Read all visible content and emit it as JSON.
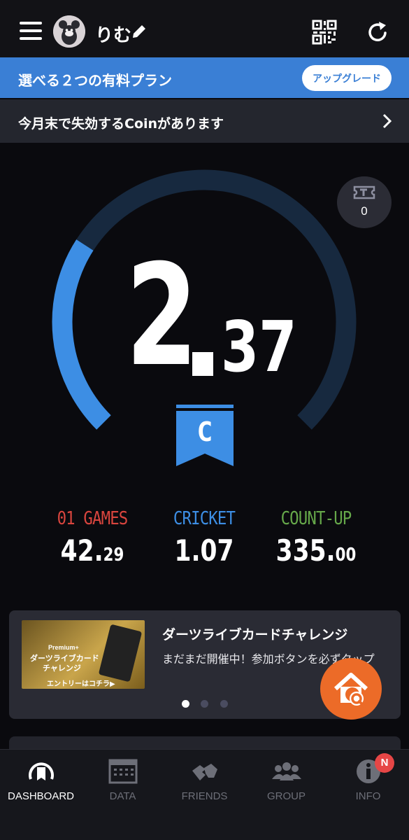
{
  "header": {
    "username": "りむ",
    "icons": [
      "menu-icon",
      "avatar",
      "edit-pencil-icon",
      "qr-code-icon",
      "reload-icon"
    ]
  },
  "upgrade_banner": {
    "text": "選べる２つの有料プラン",
    "button_label": "アップグレード",
    "color": "#3a7fd5"
  },
  "coin_notice": {
    "text": "今月末で失効するCoinがあります"
  },
  "gauge": {
    "rating_integer": "2",
    "rating_decimal": "37",
    "rating_value": 2.37,
    "rank": "C",
    "progress_fraction": 0.14,
    "ticket_count": "0",
    "colors": {
      "arc_fill": "#3d8ee4",
      "arc_track": "#17293f",
      "flag": "#3d8ee4"
    }
  },
  "stats": [
    {
      "label": "01 GAMES",
      "value_main": "42.",
      "value_small": "29",
      "color": "#d9453e"
    },
    {
      "label": "CRICKET",
      "value_main": "1.07",
      "value_small": "",
      "color": "#3d8ee4"
    },
    {
      "label": "COUNT-UP",
      "value_main": "335.",
      "value_small": "00",
      "color": "#66a84a"
    }
  ],
  "promo_card": {
    "title": "ダーツライブカードチャレンジ",
    "description": "まだまだ開催中！参加ボタンを必ずタップ",
    "image_premium": "Premium+",
    "image_title_line1": "ダーツライブカード",
    "image_title_line2": "チャレンジ",
    "image_entry": "エントリーはコチラ▶",
    "active_dot": 1,
    "dot_count": 3
  },
  "tabbar": {
    "tabs": [
      {
        "label": "DASHBOARD",
        "icon": "dashboard-icon",
        "active": true
      },
      {
        "label": "DATA",
        "icon": "data-icon",
        "active": false
      },
      {
        "label": "FRIENDS",
        "icon": "friends-icon",
        "active": false
      },
      {
        "label": "GROUP",
        "icon": "group-icon",
        "active": false
      },
      {
        "label": "INFO",
        "icon": "info-icon",
        "active": false
      }
    ],
    "info_badge": "N"
  }
}
